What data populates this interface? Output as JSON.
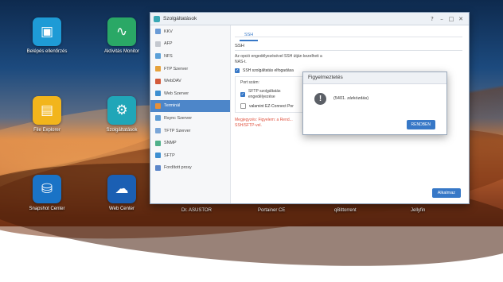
{
  "desktop": {
    "apps": [
      {
        "label": "Belépés ellenőrzés",
        "icon": "id-badge-icon",
        "color": "#1e9bd6"
      },
      {
        "label": "Aktivitás Monitor",
        "icon": "activity-monitor-icon",
        "color": "#2aa866"
      },
      {
        "label": "File Explorer",
        "icon": "file-explorer-icon",
        "color": "#f2b51c"
      },
      {
        "label": "Szolgáltatások",
        "icon": "services-icon",
        "color": "#20a6b8"
      },
      {
        "label": "Snapshot Center",
        "icon": "snapshot-icon",
        "color": "#1a73c6"
      },
      {
        "label": "Web Center",
        "icon": "web-center-icon",
        "color": "#1b5fb3"
      }
    ],
    "bottom_labels": [
      "Dr. ASUSTOR",
      "Portainer CE",
      "qBittorrent",
      "Jellyfin"
    ]
  },
  "window": {
    "title": "Szolgáltatások",
    "controls": [
      "?",
      "–",
      "□",
      "✕"
    ],
    "sidebar": [
      {
        "label": "KKV",
        "color": "#6a9bd6"
      },
      {
        "label": "AFP",
        "color": "#c4c8cf"
      },
      {
        "label": "NFS",
        "color": "#5aa0d8"
      },
      {
        "label": "FTP Szerver",
        "color": "#e6a23c"
      },
      {
        "label": "WebDAV",
        "color": "#d35a3a"
      },
      {
        "label": "Web Szerver",
        "color": "#3d8fd1"
      },
      {
        "label": "Terminál",
        "color": "#e8903a",
        "active": true
      },
      {
        "label": "Rsync Szerver",
        "color": "#5b9bd5"
      },
      {
        "label": "TFTP Szerver",
        "color": "#7aa6d8"
      },
      {
        "label": "SNMP",
        "color": "#4fb08a"
      },
      {
        "label": "SFTP",
        "color": "#3d8fd1"
      },
      {
        "label": "Fordított proxy",
        "color": "#5b86c9"
      }
    ],
    "tab": "SSH",
    "section": "SSH",
    "desc": "Az opció engedélyezésével SSH útján kezelheti a NAS-t.",
    "ssh_checkbox": "SSH szolgáltatás elfogadása",
    "port_label": "Port szám:",
    "sftp_checkbox": "SFTP szolgáltatás engedélyezése",
    "ez_connect": "valamint EZ-Connect Por",
    "warning": "Megjegyzés: Figyelem: a Rend... SSH/SFTP-vel.",
    "apply": "Alkalmaz"
  },
  "dialog": {
    "title": "Figyelmeztetés",
    "message": "(5401. zárkózdás)",
    "ok": "RENDBEN"
  }
}
